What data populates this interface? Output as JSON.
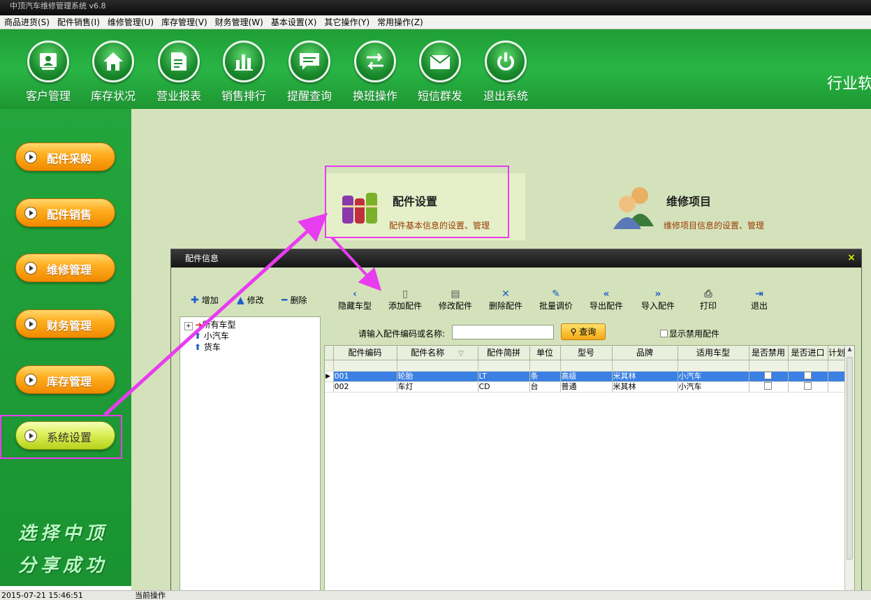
{
  "window": {
    "title": "中顶汽车维修管理系统 v6.8"
  },
  "menu": [
    "商品进货(S)",
    "配件销售(I)",
    "维修管理(U)",
    "库存管理(V)",
    "财务管理(W)",
    "基本设置(X)",
    "其它操作(Y)",
    "常用操作(Z)"
  ],
  "toolbar": [
    {
      "label": "客户管理",
      "icon": "customer-icon"
    },
    {
      "label": "库存状况",
      "icon": "home-icon"
    },
    {
      "label": "营业报表",
      "icon": "report-icon"
    },
    {
      "label": "销售排行",
      "icon": "bar-chart-icon"
    },
    {
      "label": "提醒查询",
      "icon": "message-icon"
    },
    {
      "label": "换班操作",
      "icon": "swap-icon"
    },
    {
      "label": "短信群发",
      "icon": "envelope-icon"
    },
    {
      "label": "退出系统",
      "icon": "power-icon"
    }
  ],
  "banner_right": "行业软",
  "sidebar": {
    "buttons": [
      "配件采购",
      "配件销售",
      "维修管理",
      "财务管理",
      "库存管理",
      "系统设置"
    ],
    "slogan_line1": "选择中顶",
    "slogan_line2": "分享成功"
  },
  "cards": [
    {
      "title": "配件设置",
      "desc": "配件基本信息的设置、管理"
    },
    {
      "title": "维修项目",
      "desc": "维修项目信息的设置、管理"
    }
  ],
  "status": {
    "datetime": "2015-07-21 15:46:51",
    "current_op": "当前操作"
  },
  "dialog": {
    "title": "配件信息",
    "close": "×",
    "left_actions": [
      "增加",
      "修改",
      "删除"
    ],
    "tree": [
      "所有车型",
      "小汽车",
      "货车"
    ],
    "actions": [
      "隐藏车型",
      "添加配件",
      "修改配件",
      "删除配件",
      "批量调价",
      "导出配件",
      "导入配件",
      "打印",
      "退出"
    ],
    "search_label": "请输入配件编码或名称:",
    "search_value": "",
    "search_button": "查询",
    "show_disabled": "显示禁用配件",
    "columns": [
      "配件编码",
      "配件名称",
      "配件简拼",
      "单位",
      "型号",
      "品牌",
      "适用车型",
      "是否禁用",
      "是否进口",
      "计划"
    ],
    "rows": [
      {
        "code": "001",
        "name": "轮胎",
        "abbr": "LT",
        "unit": "条",
        "model": "高级",
        "brand": "米其林",
        "car": "小汽车",
        "disabled": false,
        "imported": false
      },
      {
        "code": "002",
        "name": "车灯",
        "abbr": "CD",
        "unit": "台",
        "model": "普通",
        "brand": "米其林",
        "car": "小汽车",
        "disabled": false,
        "imported": false
      }
    ]
  },
  "colors": {
    "banner_green": "#29b545",
    "highlight": "#e83cf0",
    "orange_button": "#ffae1f",
    "selected_row": "#3b80e2"
  }
}
